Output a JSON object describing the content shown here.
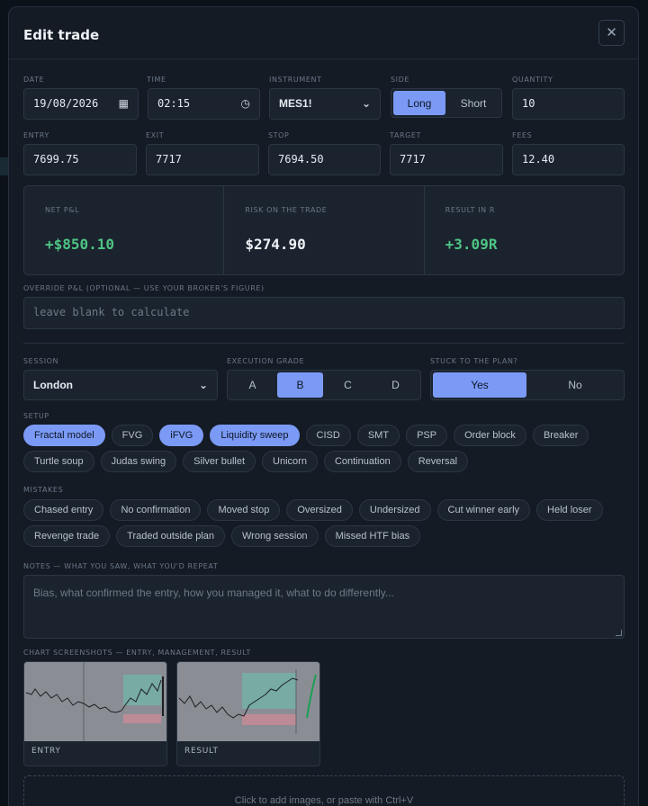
{
  "modal": {
    "title": "Edit trade"
  },
  "fields": {
    "date": {
      "label": "DATE",
      "value": "19/08/2026"
    },
    "time": {
      "label": "TIME",
      "value": "02:15"
    },
    "instrument": {
      "label": "INSTRUMENT",
      "value": "MES1!"
    },
    "side": {
      "label": "SIDE",
      "options": [
        "Long",
        "Short"
      ],
      "selected": "Long"
    },
    "quantity": {
      "label": "QUANTITY",
      "value": "10"
    },
    "entry": {
      "label": "ENTRY",
      "value": "7699.75"
    },
    "exit": {
      "label": "EXIT",
      "value": "7717"
    },
    "stop": {
      "label": "STOP",
      "value": "7694.50"
    },
    "target": {
      "label": "TARGET",
      "value": "7717"
    },
    "fees": {
      "label": "FEES",
      "value": "12.40"
    }
  },
  "stats": [
    {
      "label": "NET P&L",
      "value": "+$850.10"
    },
    {
      "label": "RISK ON THE TRADE",
      "value": "$274.90"
    },
    {
      "label": "RESULT IN R",
      "value": "+3.09R"
    }
  ],
  "override": {
    "label": "OVERRIDE P&L (OPTIONAL — USE YOUR BROKER'S FIGURE)",
    "placeholder": "leave blank to calculate"
  },
  "session": {
    "label": "SESSION",
    "value": "London"
  },
  "grade": {
    "label": "EXECUTION GRADE",
    "options": [
      "A",
      "B",
      "C",
      "D"
    ],
    "selected": "B"
  },
  "stuck": {
    "label": "STUCK TO THE PLAN?",
    "options": [
      "Yes",
      "No"
    ],
    "selected": "Yes"
  },
  "setup": {
    "label": "SETUP",
    "items": [
      "Fractal model",
      "FVG",
      "iFVG",
      "Liquidity sweep",
      "CISD",
      "SMT",
      "PSP",
      "Order block",
      "Breaker",
      "Turtle soup",
      "Judas swing",
      "Silver bullet",
      "Unicorn",
      "Continuation",
      "Reversal"
    ],
    "selected": [
      "Fractal model",
      "iFVG",
      "Liquidity sweep"
    ]
  },
  "mistakes": {
    "label": "MISTAKES",
    "items": [
      "Chased entry",
      "No confirmation",
      "Moved stop",
      "Oversized",
      "Undersized",
      "Cut winner early",
      "Held loser",
      "Revenge trade",
      "Traded outside plan",
      "Wrong session",
      "Missed HTF bias"
    ],
    "selected": []
  },
  "notes": {
    "label": "NOTES — WHAT YOU SAW, WHAT YOU'D REPEAT",
    "placeholder": "Bias, what confirmed the entry, how you managed it, what to do differently..."
  },
  "screenshots": {
    "label": "CHART SCREENSHOTS — ENTRY, MANAGEMENT, RESULT",
    "items": [
      {
        "caption": "ENTRY"
      },
      {
        "caption": "RESULT"
      }
    ],
    "dropzone": "Click to add images, or paste with Ctrl+V"
  }
}
